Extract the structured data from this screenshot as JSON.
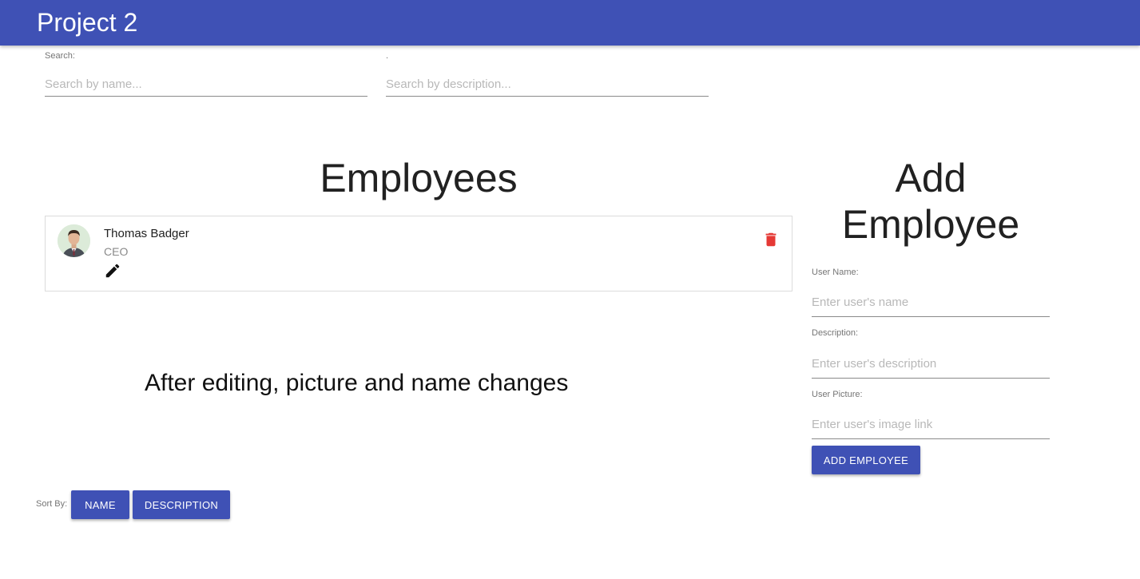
{
  "app": {
    "title": "Project 2"
  },
  "search": {
    "label": "Search:",
    "name_placeholder": "Search by name...",
    "desc_label": ".",
    "desc_placeholder": "Search by description..."
  },
  "employees": {
    "heading": "Employees",
    "list": [
      {
        "name": "Thomas Badger",
        "description": "CEO",
        "edit_icon": "pencil-icon",
        "delete_icon": "trash-icon"
      }
    ]
  },
  "note": "After editing, picture and name changes",
  "add_employee": {
    "heading_line1": "Add",
    "heading_line2": "Employee",
    "username_label": "User Name:",
    "username_placeholder": "Enter user's name",
    "description_label": "Description:",
    "description_placeholder": "Enter user's description",
    "picture_label": "User Picture:",
    "picture_placeholder": "Enter user's image link",
    "submit_label": "ADD EMPLOYEE"
  },
  "sort": {
    "label": "Sort By:",
    "name_button": "NAME",
    "description_button": "DESCRIPTION"
  },
  "colors": {
    "primary": "#3f51b5",
    "delete": "#e53935"
  }
}
